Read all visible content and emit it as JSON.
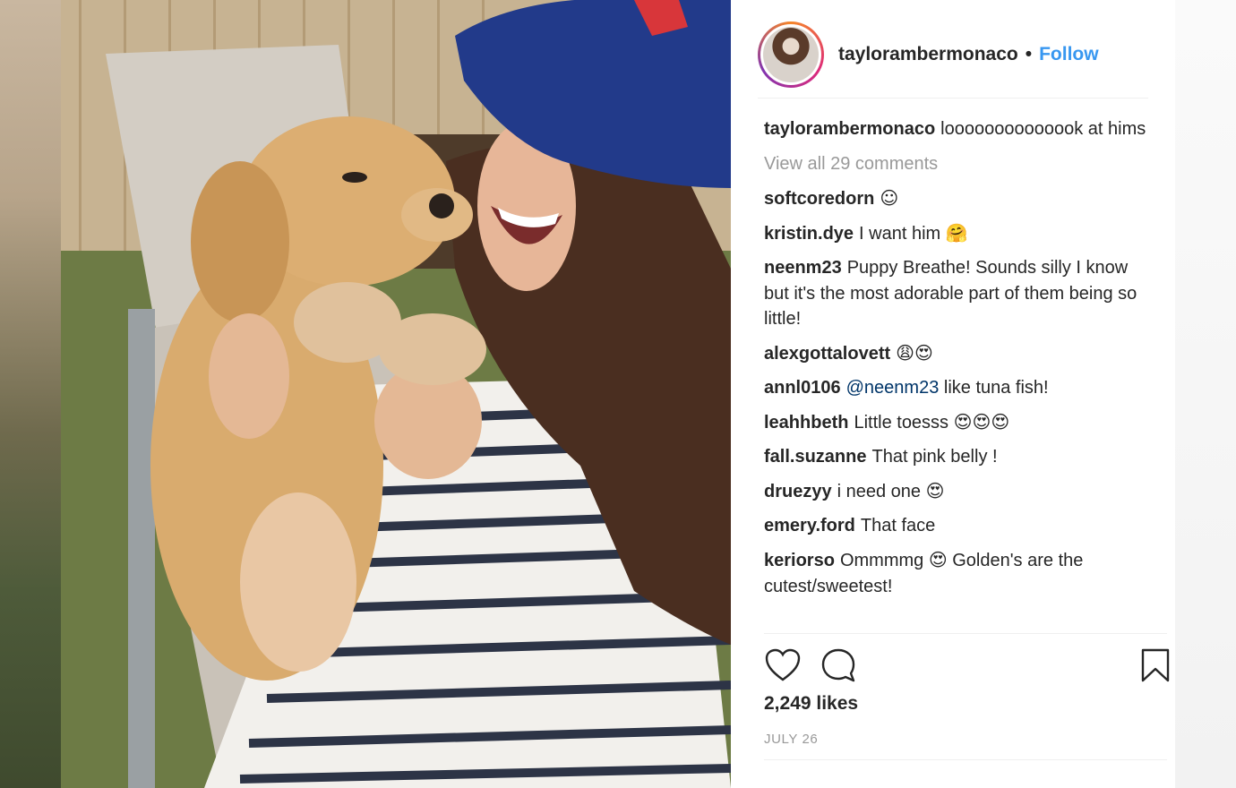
{
  "post": {
    "username": "taylorambermonaco",
    "separator": "•",
    "follow_label": "Follow",
    "caption_user": "taylorambermonaco",
    "caption_text": "loooooooooooook at hims",
    "view_all_comments": "View all 29 comments",
    "likes": "2,249 likes",
    "date": "JULY 26"
  },
  "comments": [
    {
      "user": "softcoredorn",
      "text": "",
      "emoji": "☺"
    },
    {
      "user": "kristin.dye",
      "text": "I want him",
      "emoji": "🤗"
    },
    {
      "user": "neenm23",
      "text": "Puppy Breathe! Sounds silly I know but it's the most adorable part of them being so little!",
      "emoji": ""
    },
    {
      "user": "alexgottalovett",
      "text": "",
      "emoji": "😩😍"
    },
    {
      "user": "annl0106",
      "mention": "@neenm23",
      "text": "like tuna fish!",
      "emoji": ""
    },
    {
      "user": "leahhbeth",
      "text": "Little toesss",
      "emoji": "😍😍😍"
    },
    {
      "user": "fall.suzanne",
      "text": "That pink belly !",
      "emoji": ""
    },
    {
      "user": "druezyy",
      "text": "i need one",
      "emoji": "😍"
    },
    {
      "user": "emery.ford",
      "text": "That face",
      "emoji": ""
    },
    {
      "user": "keriorso",
      "text": "Ommmmg",
      "emoji": "😍",
      "text2": "Golden's are the cutest/sweetest!"
    }
  ],
  "icons": {
    "like": "heart-icon",
    "comment": "speech-bubble-icon",
    "save": "bookmark-icon"
  },
  "colors": {
    "follow": "#3897f0",
    "mention": "#003569",
    "muted": "#999999"
  }
}
